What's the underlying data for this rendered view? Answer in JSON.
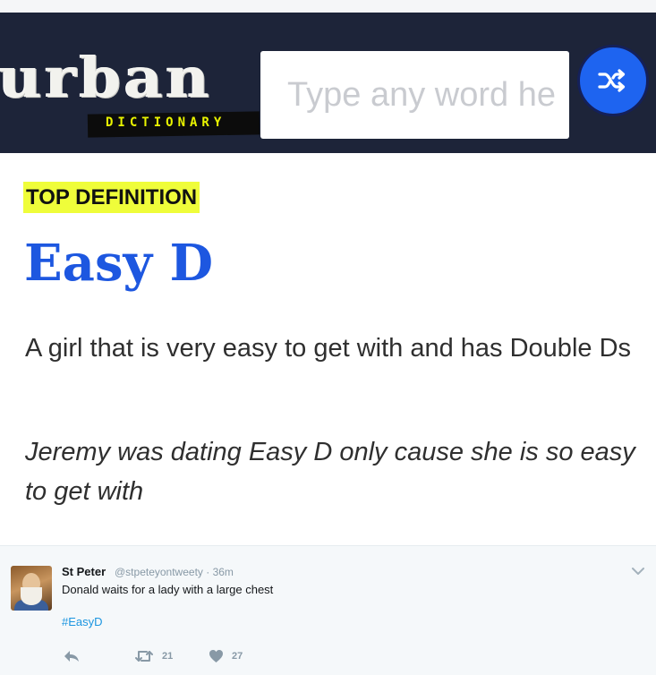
{
  "header": {
    "logo_word": "urban",
    "logo_sub": "DICTIONARY",
    "search_placeholder": "Type any word he",
    "random_icon": "shuffle-icon"
  },
  "definition": {
    "badge": "TOP DEFINITION",
    "word": "Easy D",
    "meaning": "A girl that is very easy to get with and has Double Ds",
    "example": "Jeremy was dating Easy D only cause she is so easy to get with"
  },
  "tweet": {
    "author_name": "St Peter",
    "meta": "@stpeteyontweety · 36m",
    "text": "Donald waits for a lady with a large chest",
    "hashtag": "#EasyD",
    "retweet_count": "21",
    "like_count": "27",
    "icons": [
      "reply-icon",
      "retweet-icon",
      "heart-icon",
      "chevron-down-icon"
    ]
  },
  "colors": {
    "header_bg": "#1d2439",
    "accent_blue": "#1d57e0",
    "button_blue": "#1e64f0",
    "badge_yellow": "#effd3a",
    "tweet_bg": "#f5f8fa",
    "hashtag_blue": "#1b95e0"
  }
}
